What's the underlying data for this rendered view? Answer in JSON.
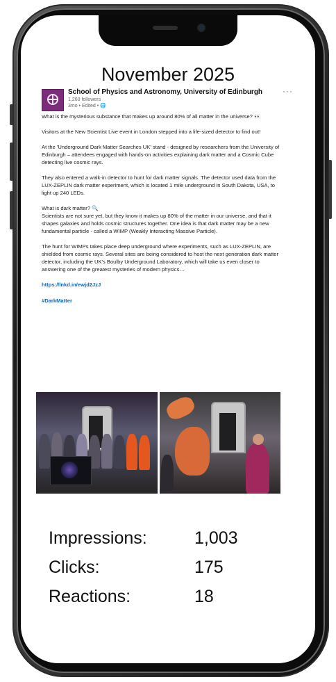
{
  "header": {
    "month_title": "November 2025"
  },
  "post": {
    "org_name": "School of Physics and Astronomy, University of Edinburgh",
    "followers": "1,260 followers",
    "meta": "3mo • Edited • 🌐",
    "more_icon": "···",
    "paragraphs": [
      "What is the mysterious substance that makes up around 80% of all matter in the universe? 👀",
      "Visitors at the New Scientist Live event in London stepped into a life-sized detector to find out!",
      "At the 'Underground Dark Matter Searches UK' stand - designed by researchers from the University of Edinburgh – attendees engaged with hands-on activities explaining dark matter and a Cosmic Cube detecting live cosmic rays.",
      "They also entered a walk-in detector to hunt for dark matter signals. The detector used data from the LUX-ZEPLIN dark matter experiment, which is located 1 mile underground in South Dakota, USA, to light up 240 LEDs.",
      "What is dark matter? 🔍\nScientists are not sure yet, but they know it makes up 80% of the matter in our universe, and that it shapes galaxies and holds cosmic structures together. One idea is that dark matter may be a new fundamental particle - called a WIMP (Weakly Interacting Massive Particle).",
      "The hunt for WIMPs takes place deep underground where experiments, such as LUX-ZEPLIN, are shielded from cosmic rays. Several sites are being considered to host the next generation dark matter detector, including the UK's Boulby Underground Laboratory, which will take us even closer to answering one of the greatest mysteries of modern physics…"
    ],
    "link": "https://lnkd.in/ewjd2JzJ",
    "hashtag": "#DarkMatter"
  },
  "stats": {
    "impressions_label": "Impressions:",
    "impressions_value": "1,003",
    "clicks_label": "Clicks:",
    "clicks_value": "175",
    "reactions_label": "Reactions:",
    "reactions_value": "18"
  },
  "colors": {
    "link": "#0a66c2",
    "logo": "#7b2c7a"
  }
}
